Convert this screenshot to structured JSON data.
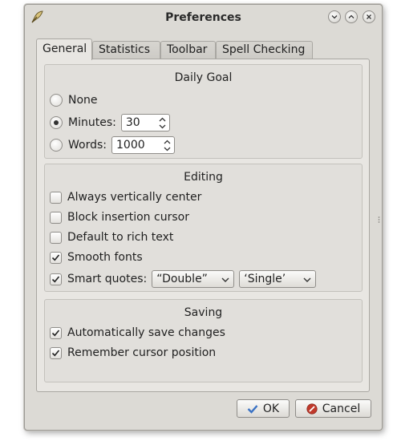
{
  "window": {
    "title": "Preferences"
  },
  "tabs": [
    {
      "label": "General",
      "active": true
    },
    {
      "label": "Statistics",
      "active": false
    },
    {
      "label": "Toolbar",
      "active": false
    },
    {
      "label": "Spell Checking",
      "active": false
    }
  ],
  "daily_goal": {
    "title": "Daily Goal",
    "none_label": "None",
    "minutes_label": "Minutes:",
    "minutes_value": "30",
    "words_label": "Words:",
    "words_value": "1000",
    "selected": "minutes"
  },
  "editing": {
    "title": "Editing",
    "always_center": {
      "label": "Always vertically center",
      "checked": false
    },
    "block_cursor": {
      "label": "Block insertion cursor",
      "checked": false
    },
    "rich_text": {
      "label": "Default to rich text",
      "checked": false
    },
    "smooth_fonts": {
      "label": "Smooth fonts",
      "checked": true
    },
    "smart_quotes": {
      "label": "Smart quotes:",
      "checked": true,
      "double_value": "“Double”",
      "single_value": "‘Single’"
    }
  },
  "saving": {
    "title": "Saving",
    "auto_save": {
      "label": "Automatically save changes",
      "checked": true
    },
    "remember_cursor": {
      "label": "Remember cursor position",
      "checked": true
    }
  },
  "buttons": {
    "ok_label": "OK",
    "cancel_label": "Cancel"
  },
  "colors": {
    "window_bg": "#dcdad5",
    "panel_bg": "#e8e6e2",
    "ok_icon": "#3a72c4",
    "cancel_icon": "#c0392b"
  },
  "icons": {
    "app": "quill-icon",
    "ok": "checkmark-icon",
    "cancel": "cancel-icon"
  }
}
